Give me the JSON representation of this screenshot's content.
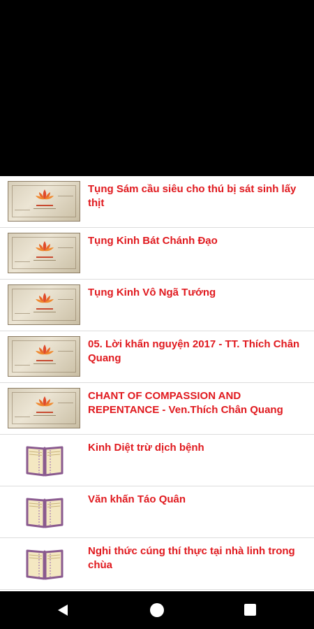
{
  "list": {
    "items": [
      {
        "title": "Tụng Sám cầu siêu cho thú bị sát sinh lấy thịt",
        "thumbnail": "lotus-image"
      },
      {
        "title": "Tụng Kinh Bát Chánh Đạo",
        "thumbnail": "lotus-image"
      },
      {
        "title": "Tụng Kinh Vô Ngã Tướng",
        "thumbnail": "lotus-image"
      },
      {
        "title": "05. Lời khấn nguyện 2017 - TT. Thích Chân Quang",
        "thumbnail": "lotus-image"
      },
      {
        "title": "CHANT OF COMPASSION AND REPENTANCE - Ven.Thích Chân Quang",
        "thumbnail": "lotus-image"
      },
      {
        "title": "Kinh Diệt trừ dịch bệnh",
        "thumbnail": "book-icon"
      },
      {
        "title": "Văn khấn Táo Quân",
        "thumbnail": "book-icon"
      },
      {
        "title": "Nghi thức cúng thí thực tại nhà linh trong chùa",
        "thumbnail": "book-icon"
      }
    ]
  },
  "nav": {
    "back_icon": "back-triangle-icon",
    "home_icon": "home-circle-icon",
    "recent_icon": "recent-apps-square-icon"
  },
  "colors": {
    "title_red": "#e0191e",
    "book_purple": "#8a5a8f",
    "background": "#ffffff"
  }
}
